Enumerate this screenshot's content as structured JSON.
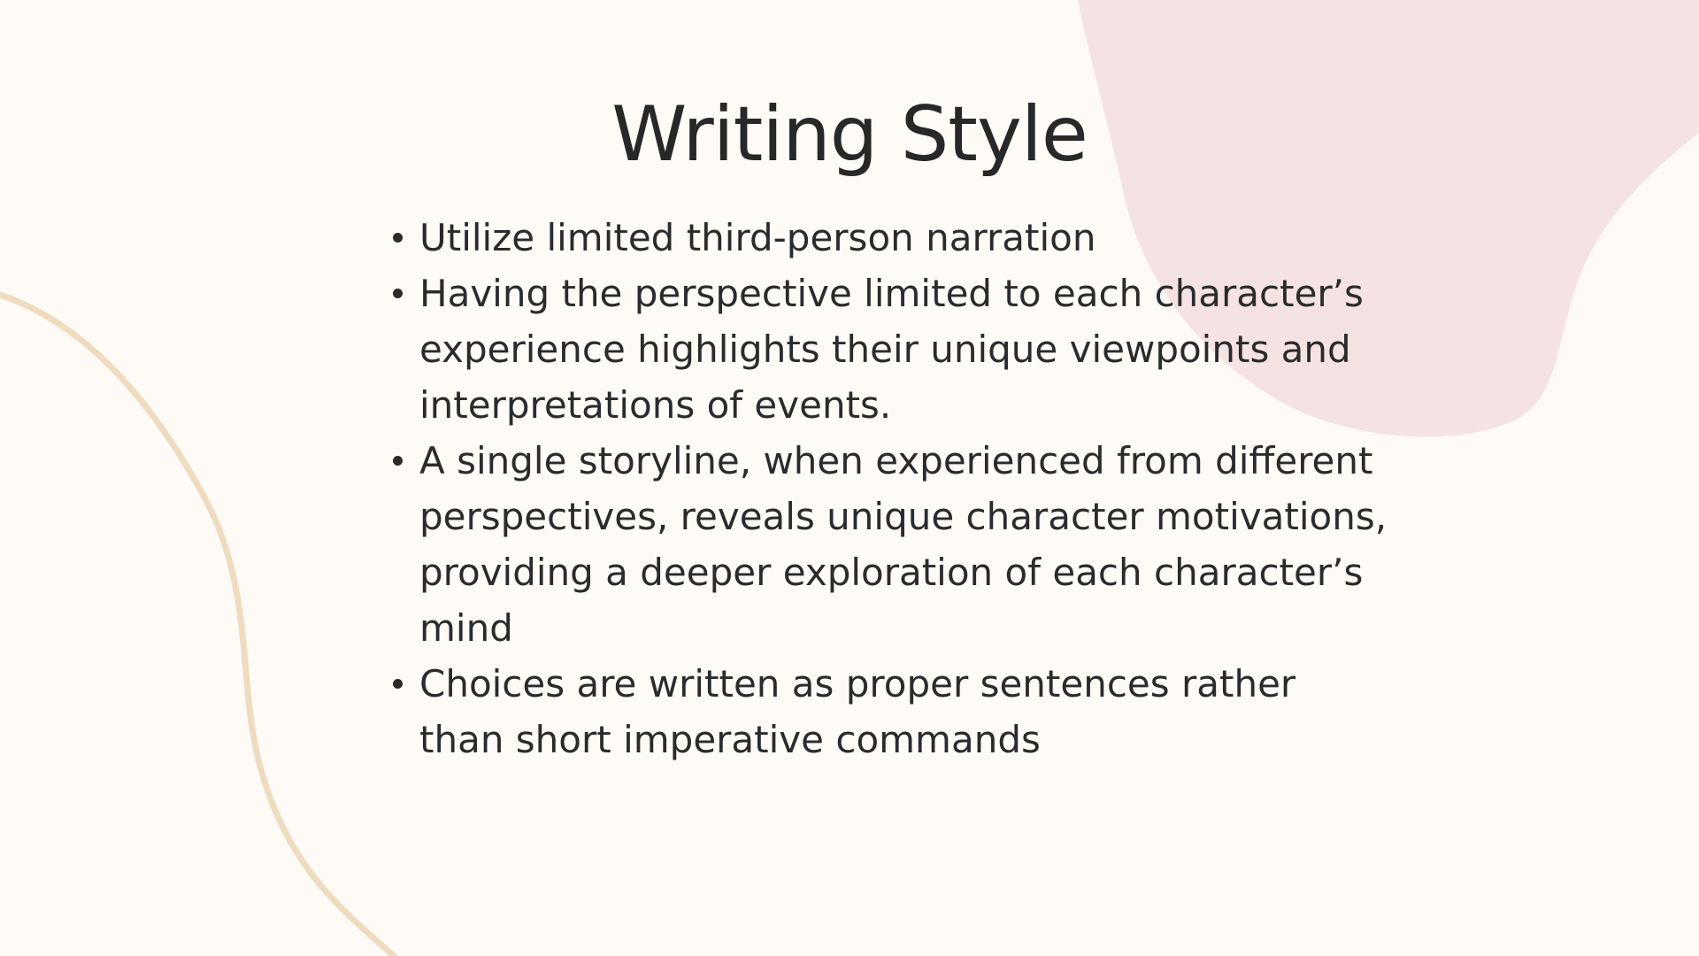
{
  "slide": {
    "title": "Writing Style",
    "bullets": [
      "Utilize limited third-person narration",
      "Having the perspective limited to each character’s experience highlights their unique viewpoints and interpretations of events.",
      "A single storyline, when experienced from different perspectives, reveals unique character motivations, providing a deeper exploration of each character’s mind",
      "Choices are written as proper sentences rather than short imperative commands"
    ]
  },
  "colors": {
    "background": "#fefbf7",
    "blob": "#f5e3e3",
    "curve": "#efdcc0",
    "text": "#2b2b2b"
  }
}
